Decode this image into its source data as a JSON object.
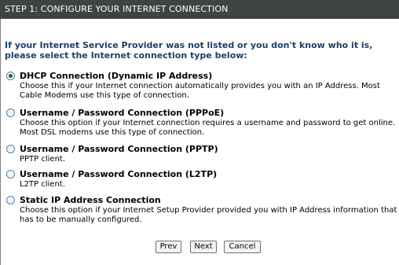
{
  "header": {
    "title": "STEP 1: CONFIGURE YOUR INTERNET CONNECTION"
  },
  "intro": "If your Internet Service Provider was not listed or you don't know who it is, please select the Internet connection type below:",
  "options": [
    {
      "label": "DHCP Connection (Dynamic IP Address)",
      "description": "Choose this if your Internet connection automatically provides you with an IP Address. Most Cable Modems use this type of connection.",
      "checked": true
    },
    {
      "label": "Username / Password Connection (PPPoE)",
      "description": "Choose this option if your Internet connection requires a username and password to get online. Most DSL modems use this type of connection.",
      "checked": false
    },
    {
      "label": "Username / Password Connection (PPTP)",
      "description": "PPTP client.",
      "checked": false
    },
    {
      "label": "Username / Password Connection (L2TP)",
      "description": "L2TP client.",
      "checked": false
    },
    {
      "label": "Static IP Address Connection",
      "description": "Choose this option if your Internet Setup Provider provided you with IP Address information that has to be manually configured.",
      "checked": false
    }
  ],
  "buttons": {
    "prev": "Prev",
    "next": "Next",
    "cancel": "Cancel"
  }
}
